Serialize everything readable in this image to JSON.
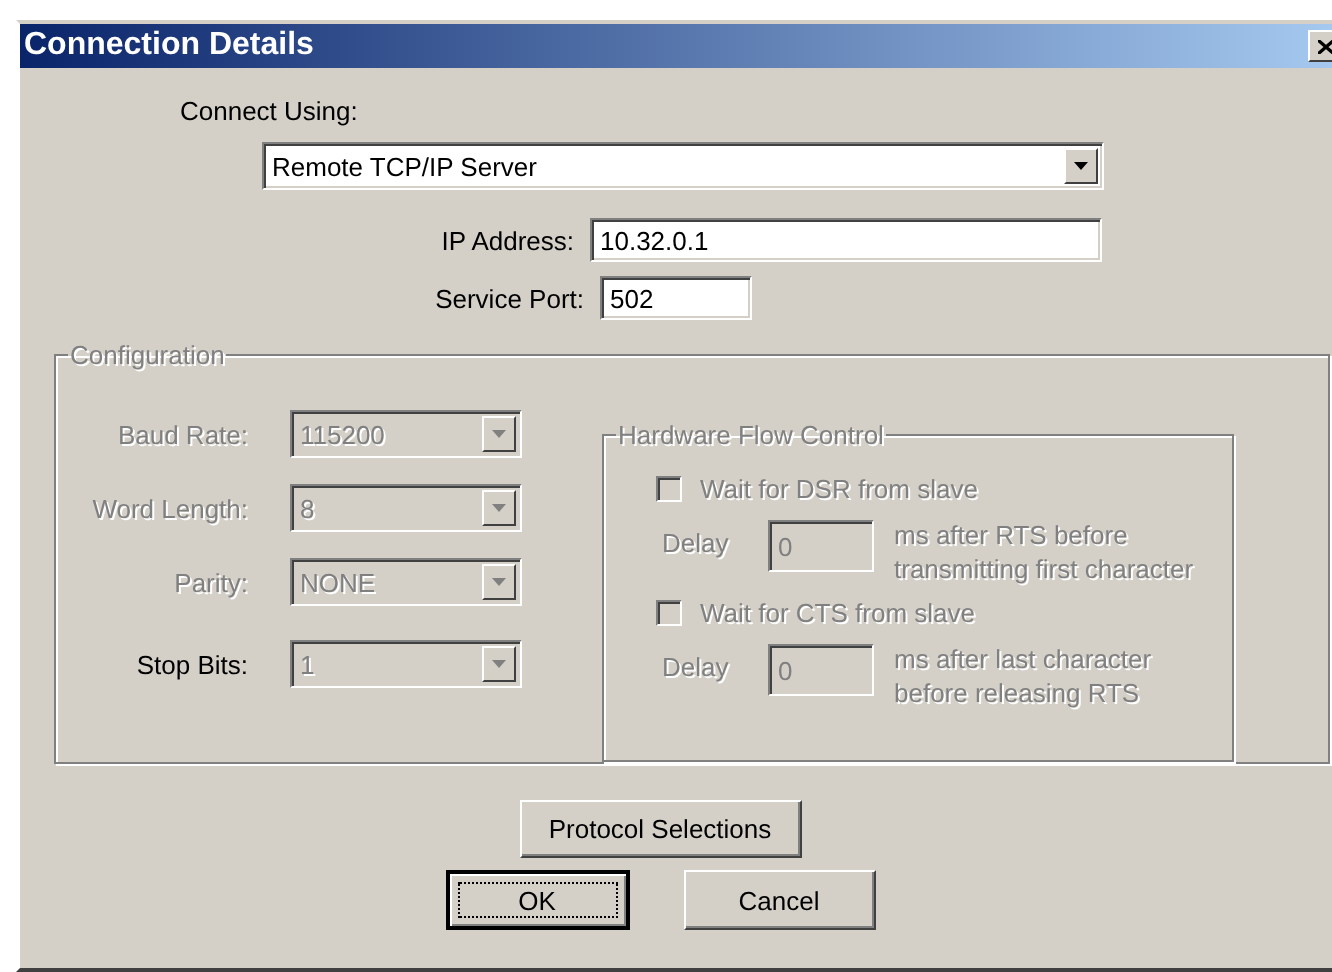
{
  "window": {
    "title": "Connection Details"
  },
  "connect_using": {
    "label": "Connect Using:",
    "value": "Remote TCP/IP Server",
    "disabled": false
  },
  "ip_address": {
    "label": "IP Address:",
    "value": "10.32.0.1"
  },
  "service_port": {
    "label": "Service Port:",
    "value": "502"
  },
  "configuration": {
    "title": "Configuration",
    "disabled": true,
    "fields": [
      {
        "label": "Baud Rate:",
        "value": "115200",
        "label_disabled": true,
        "disabled": true
      },
      {
        "label": "Word Length:",
        "value": "8",
        "label_disabled": true,
        "disabled": true
      },
      {
        "label": "Parity:",
        "value": "NONE",
        "label_disabled": true,
        "disabled": true
      },
      {
        "label": "Stop Bits:",
        "value": "1",
        "label_disabled": false,
        "disabled": true
      }
    ]
  },
  "hardware_flow_control": {
    "title": "Hardware Flow Control",
    "disabled": true,
    "options": [
      {
        "label": "Wait for DSR from slave",
        "checked": false,
        "delay_label": "Delay",
        "delay_value": "0",
        "note": "ms after RTS before transmitting first character"
      },
      {
        "label": "Wait for CTS from slave",
        "checked": false,
        "delay_label": "Delay",
        "delay_value": "0",
        "note": "ms after last character before releasing RTS"
      }
    ]
  },
  "buttons": [
    {
      "label": "Protocol Selections",
      "default": false
    },
    {
      "label": "OK",
      "default": true
    },
    {
      "label": "Cancel",
      "default": false
    }
  ]
}
